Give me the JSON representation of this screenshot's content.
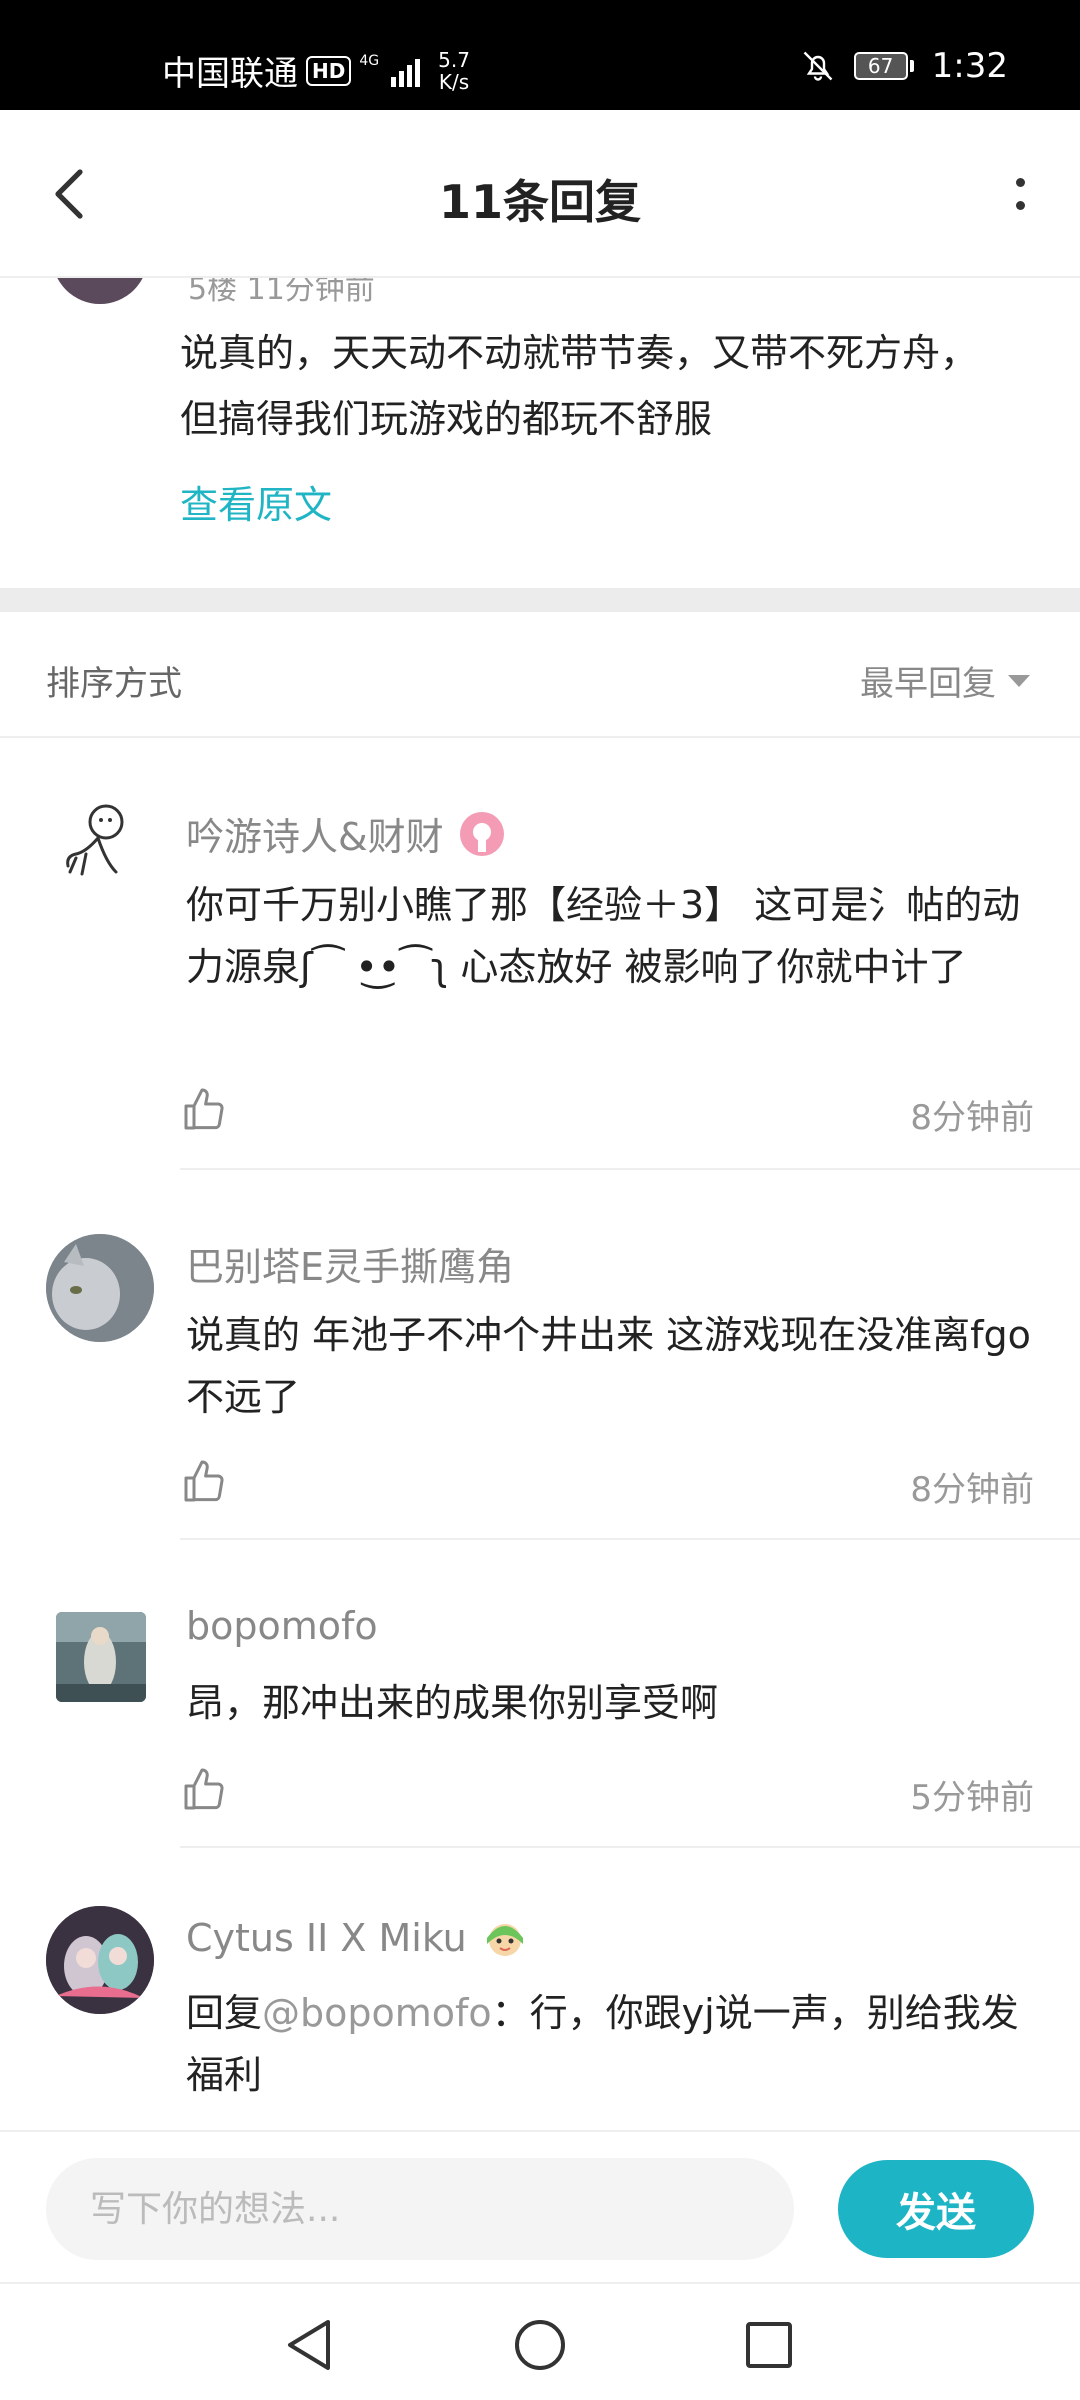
{
  "status_bar": {
    "carrier": "中国联通",
    "hd": "HD",
    "network": "4G",
    "speed_value": "5.7",
    "speed_unit": "K/s",
    "battery": "67",
    "time": "1:32"
  },
  "header": {
    "title": "11条回复",
    "back_icon": "chevron-left-icon",
    "more_icon": "more-vertical-icon"
  },
  "original_post": {
    "meta": "5楼  11分钟前",
    "text": "说真的，天天动不动就带节奏，又带不死方舟，但搞得我们玩游戏的都玩不舒服",
    "view_original": "查看原文"
  },
  "sort": {
    "label": "排序方式",
    "selected": "最早回复"
  },
  "comments": [
    {
      "author": "吟游诗人&财财",
      "text": "你可千万别小瞧了那【经验＋3】 这可是氵帖的动力源泉ʃ⁀ •͜•⁀ʅ  心态放好  被影响了你就中计了",
      "time": "8分钟前",
      "badge": "pink-badge-icon"
    },
    {
      "author": "巴别塔E灵手撕鹰角",
      "text": "说真的  年池子不冲个井出来  这游戏现在没准离fgo不远了",
      "time": "8分钟前"
    },
    {
      "author": "bopomofo",
      "text": "昂，那冲出来的成果你别享受啊",
      "time": "5分钟前"
    },
    {
      "author": "Cytus II X Miku",
      "reply_prefix": "回复",
      "mention": "@bopomofo",
      "text": "：行，你跟yj说一声，别给我发福利",
      "badge": "miku-badge-icon"
    }
  ],
  "input": {
    "placeholder": "写下你的想法...",
    "send_label": "发送"
  },
  "colors": {
    "accent": "#1db5c5",
    "link": "#1fb5c4"
  }
}
